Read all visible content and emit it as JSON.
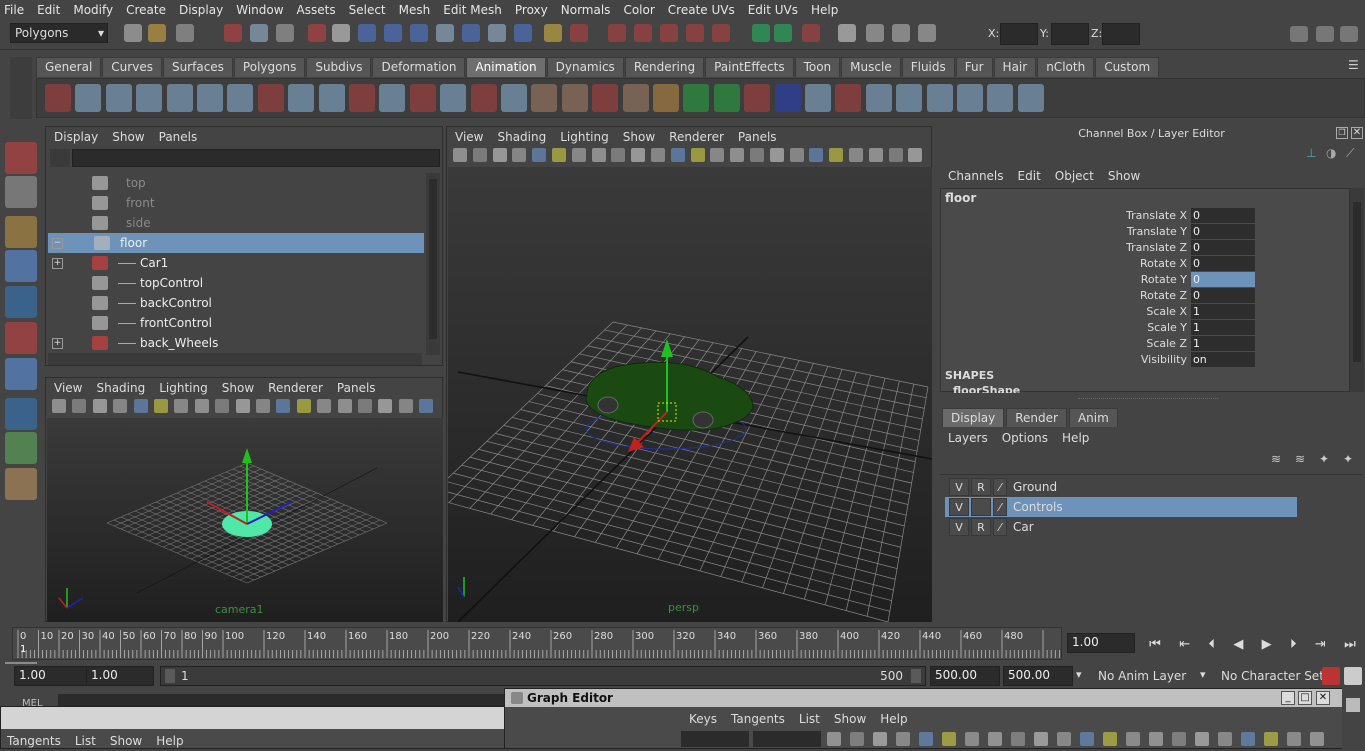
{
  "menubar": [
    "File",
    "Edit",
    "Modify",
    "Create",
    "Display",
    "Window",
    "Assets",
    "Select",
    "Mesh",
    "Edit Mesh",
    "Proxy",
    "Normals",
    "Color",
    "Create UVs",
    "Edit UVs",
    "Help"
  ],
  "statusline": {
    "mode": "Polygons",
    "x_label": "X:",
    "y_label": "Y:",
    "z_label": "Z:"
  },
  "shelf_tabs": [
    "General",
    "Curves",
    "Surfaces",
    "Polygons",
    "Subdivs",
    "Deformation",
    "Animation",
    "Dynamics",
    "Rendering",
    "PaintEffects",
    "Toon",
    "Muscle",
    "Fluids",
    "Fur",
    "Hair",
    "nCloth",
    "Custom"
  ],
  "shelf_active": "Animation",
  "outliner": {
    "menu": [
      "Display",
      "Show",
      "Panels"
    ],
    "items": [
      {
        "label": "top",
        "type": "camera",
        "dim": true,
        "expand": ""
      },
      {
        "label": "front",
        "type": "camera",
        "dim": true,
        "expand": ""
      },
      {
        "label": "side",
        "type": "camera",
        "dim": true,
        "expand": ""
      },
      {
        "label": "floor",
        "type": "curve",
        "dim": false,
        "expand": "−",
        "selected": true
      },
      {
        "label": "Car1",
        "type": "mesh",
        "dim": false,
        "expand": "+"
      },
      {
        "label": "topControl",
        "type": "curve",
        "dim": false,
        "expand": ""
      },
      {
        "label": "backControl",
        "type": "curve",
        "dim": false,
        "expand": ""
      },
      {
        "label": "frontControl",
        "type": "curve",
        "dim": false,
        "expand": ""
      },
      {
        "label": "back_Wheels",
        "type": "mesh",
        "dim": false,
        "expand": "+"
      }
    ]
  },
  "viewport_small": {
    "menu": [
      "View",
      "Shading",
      "Lighting",
      "Show",
      "Renderer",
      "Panels"
    ],
    "camera": "camera1"
  },
  "viewport_main": {
    "menu": [
      "View",
      "Shading",
      "Lighting",
      "Show",
      "Renderer",
      "Panels"
    ],
    "camera": "persp"
  },
  "channelbox": {
    "title": "Channel Box / Layer Editor",
    "menu": [
      "Channels",
      "Edit",
      "Object",
      "Show"
    ],
    "object": "floor",
    "channels": [
      {
        "name": "Translate X",
        "value": "0"
      },
      {
        "name": "Translate Y",
        "value": "0"
      },
      {
        "name": "Translate Z",
        "value": "0"
      },
      {
        "name": "Rotate X",
        "value": "0"
      },
      {
        "name": "Rotate Y",
        "value": "0",
        "selected": true
      },
      {
        "name": "Rotate Z",
        "value": "0"
      },
      {
        "name": "Scale X",
        "value": "1"
      },
      {
        "name": "Scale Y",
        "value": "1"
      },
      {
        "name": "Scale Z",
        "value": "1"
      },
      {
        "name": "Visibility",
        "value": "on"
      }
    ],
    "shapes_header": "SHAPES",
    "shape_name": "floorShape"
  },
  "layer_editor": {
    "tabs": [
      "Display",
      "Render",
      "Anim"
    ],
    "active_tab": "Display",
    "menu": [
      "Layers",
      "Options",
      "Help"
    ],
    "layers": [
      {
        "v": "V",
        "r": "R",
        "name": "Ground",
        "selected": false
      },
      {
        "v": "V",
        "r": "",
        "name": "Controls",
        "selected": true
      },
      {
        "v": "V",
        "r": "R",
        "name": "Car",
        "selected": false
      }
    ]
  },
  "timeline": {
    "ticks": [
      "0",
      "10",
      "20",
      "30",
      "40",
      "50",
      "60",
      "70",
      "80",
      "90",
      "100",
      "120",
      "140",
      "160",
      "180",
      "200",
      "220",
      "240",
      "260",
      "280",
      "300",
      "320",
      "340",
      "360",
      "380",
      "400",
      "420",
      "440",
      "460",
      "480",
      "50"
    ],
    "current_frame_marker": "1",
    "current_time": "1.00"
  },
  "range": {
    "start_time": "1.00",
    "playback_start": "1.00",
    "slider_start": "1",
    "slider_end": "500",
    "playback_end": "500.00",
    "end_time": "500.00",
    "anim_layer": "No Anim Layer",
    "character_set": "No Character Set"
  },
  "commandline": {
    "label": "MEL"
  },
  "graph_editor": {
    "title": "Graph Editor",
    "menu": [
      "Keys",
      "Tangents",
      "List",
      "Show",
      "Help"
    ]
  },
  "graph_editor_back": {
    "menu": [
      "Tangents",
      "List",
      "Show",
      "Help"
    ]
  },
  "colors": {
    "selection": "#6d93bb",
    "grid": "#8a8a8a",
    "car": "#1a4a12",
    "manip_y": "#21c021",
    "manip_x": "#c02020",
    "manip_z": "#2020c0"
  }
}
